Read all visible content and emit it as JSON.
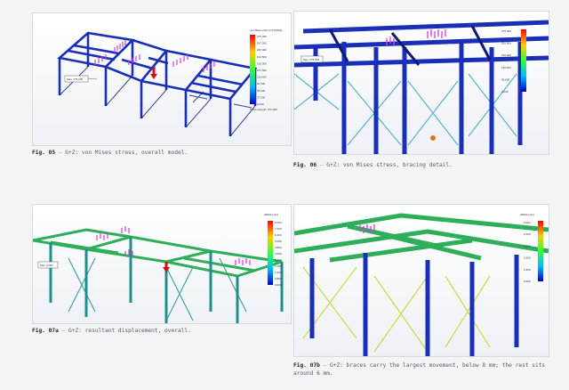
{
  "figures": [
    {
      "number": "Fig. 05",
      "separator": "—",
      "text": "G+Z: von Mises stress, overall model.",
      "legend_title": "von Mises (N/mm^2 (MPa))",
      "legend_ticks": [
        "275.000",
        "247.500",
        "220.000",
        "192.500",
        "165.000",
        "137.500",
        "110.000",
        "82.500",
        "55.000",
        "27.500",
        "0.000"
      ],
      "legend_footer": "Yield strength: 275.000",
      "probe_label": "Max: 275.000"
    },
    {
      "number": "Fig. 06",
      "separator": "—",
      "text": "G+Z: von Mises stress, bracing detail.",
      "legend_title": "von Mises (N/mm^2 (MPa))",
      "legend_ticks": [
        "275.000",
        "220.000",
        "165.000",
        "110.000",
        "55.000",
        "0.000"
      ],
      "probe_label": "Max: 275.000"
    },
    {
      "number": "Fig. 07a",
      "separator": "—",
      "text": "G+Z: resultant displacement, overall.",
      "legend_title": "URES (mm)",
      "legend_ticks": [
        "8.000",
        "7.200",
        "6.400",
        "5.600",
        "4.800",
        "4.000",
        "3.200",
        "2.400",
        "1.600",
        "0.800",
        "0.000"
      ],
      "probe_label": "Max: 8.000"
    },
    {
      "number": "Fig. 07b",
      "separator": "—",
      "text": "G+Z: braces carry the largest movement, below 8 mm; the rest sits around 6 mm.",
      "legend_title": "URES (mm)",
      "legend_ticks": [
        "8.000",
        "6.400",
        "4.800",
        "3.200",
        "1.600",
        "0.000"
      ]
    }
  ],
  "colors": {
    "stress_blue": "#1a2fb8",
    "stress_dark": "#0d1a7a",
    "disp_green": "#2fae5a",
    "disp_teal": "#1e8f8a",
    "load_arrow": "#d23fd6",
    "max_arrow": "#d01010",
    "brace_yellow": "#c8d83a"
  }
}
